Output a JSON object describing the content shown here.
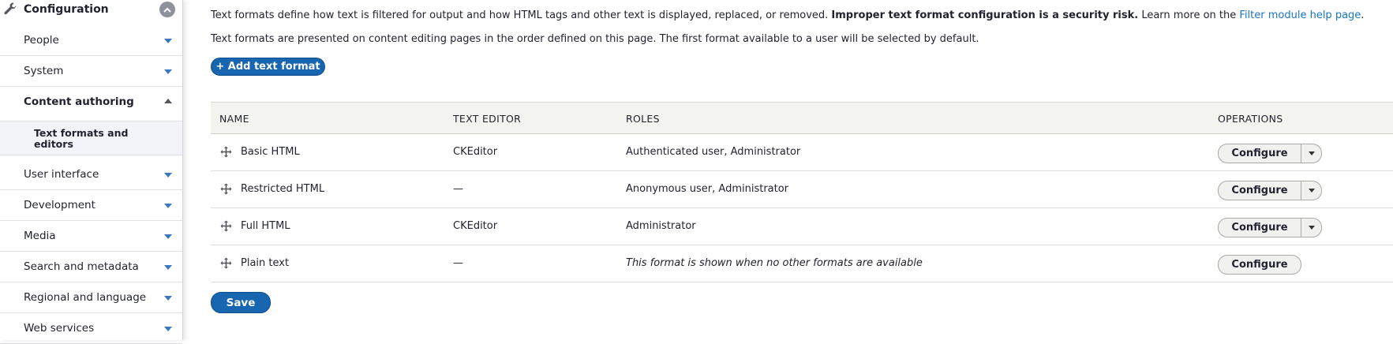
{
  "sidebar": {
    "header": {
      "title": "Configuration",
      "icon": "wrench-icon"
    },
    "items": [
      {
        "label": "People"
      },
      {
        "label": "System"
      },
      {
        "label": "Content authoring"
      },
      {
        "label": "User interface"
      },
      {
        "label": "Development"
      },
      {
        "label": "Media"
      },
      {
        "label": "Search and metadata"
      },
      {
        "label": "Regional and language"
      },
      {
        "label": "Web services"
      }
    ],
    "active_sub": {
      "label": "Text formats and editors"
    }
  },
  "main": {
    "description1": {
      "before": "Text formats define how text is filtered for output and how HTML tags and other text is displayed, replaced, or removed.",
      "warning": "Improper text format configuration is a security risk.",
      "after": "Learn more on the",
      "link": "Filter module help page",
      "end": "."
    },
    "description2": "Text formats are presented on content editing pages in the order defined on this page. The first format available to a user will be selected by default.",
    "add_button": "+ Add text format",
    "table": {
      "headers": {
        "name": "NAME",
        "editor": "TEXT EDITOR",
        "roles": "ROLES",
        "operations": "OPERATIONS"
      },
      "rows": [
        {
          "name": "Basic HTML",
          "editor": "CKEditor",
          "roles": "Authenticated user, Administrator",
          "operation": "Configure"
        },
        {
          "name": "Restricted HTML",
          "editor": "—",
          "roles": "Anonymous user, Administrator",
          "operation": "Configure"
        },
        {
          "name": "Full HTML",
          "editor": "CKEditor",
          "roles": "Administrator",
          "operation": "Configure"
        },
        {
          "name": "Plain text",
          "editor": "—",
          "roles": "This format is shown when no other formats are available",
          "operation": "Configure"
        }
      ]
    },
    "save_button": "Save"
  },
  "colors": {
    "primary": "#1865b0",
    "link": "#1b74c4",
    "arrow": "#3b78c3"
  }
}
